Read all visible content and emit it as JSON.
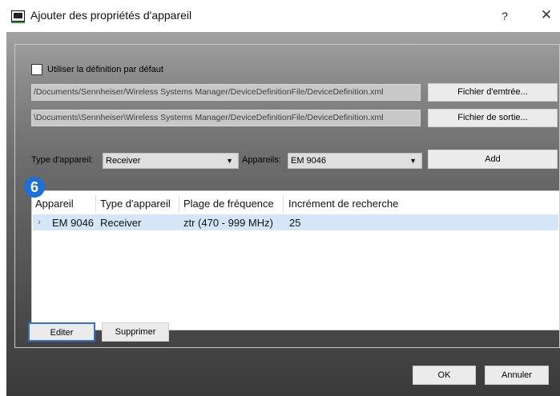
{
  "window": {
    "title": "Ajouter des propriétés d'appareil",
    "help": "?",
    "close": "✕"
  },
  "options": {
    "use_default_label": "Utiliser la définition par défaut",
    "use_default_checked": false
  },
  "files": {
    "input_path": "/Documents/Sennheiser/Wireless Systems Manager/DeviceDefinitionFile/DeviceDefinition.xml",
    "input_button": "Fichier d'emtrée...",
    "output_path": "\\Documents\\Sennheiser\\Wireless Systems Manager/DeviceDefinitionFile/DeviceDefinition.xml",
    "output_button": "Fichier de sortie..."
  },
  "filters": {
    "device_type_label": "Type d'appareil:",
    "device_type_value": "Receiver",
    "devices_label": "Appareils:",
    "devices_value": "EM 9046",
    "add_button": "Add"
  },
  "badge": "6",
  "table": {
    "columns": [
      "Appareil",
      "Type d'appareil",
      "Plage de fréquence",
      "Incrément de recherche"
    ],
    "rows": [
      {
        "expander": "›",
        "device": "EM 9046",
        "type": "Receiver",
        "range": "ztr (470 - 999 MHz)",
        "step": "25"
      }
    ]
  },
  "actions": {
    "edit": "Editer",
    "delete": "Supprimer",
    "ok": "OK",
    "cancel": "Annuler"
  },
  "colors": {
    "accent": "#1f6fd6",
    "selection": "#d4e6f7"
  }
}
